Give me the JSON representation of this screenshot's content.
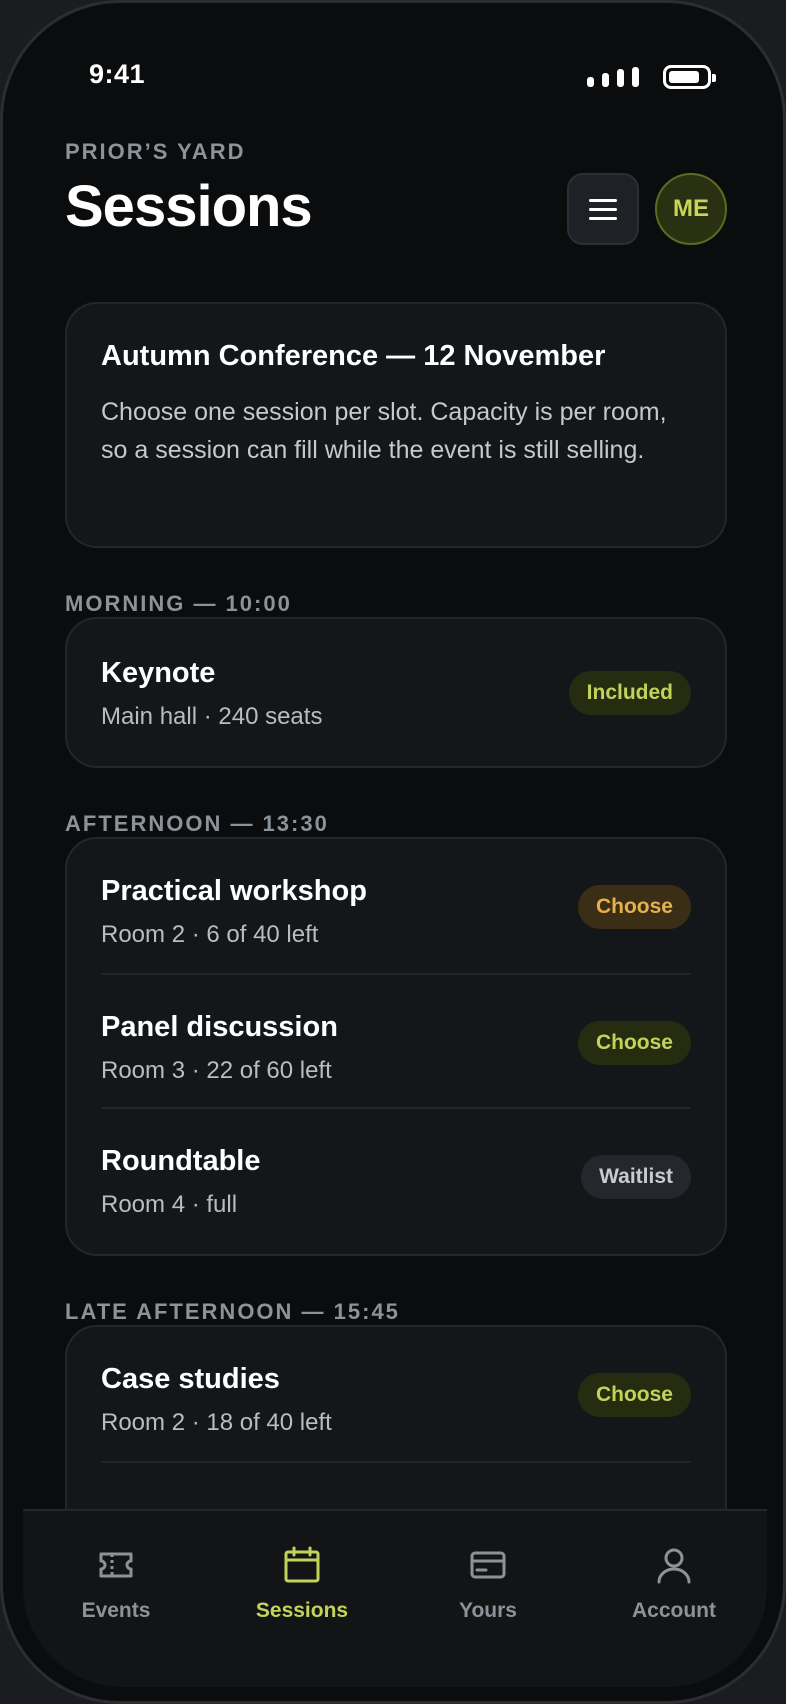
{
  "status_bar": {
    "time": "9:41"
  },
  "header": {
    "overline": "PRIOR’S YARD",
    "title": "Sessions",
    "avatar_initials": "ME"
  },
  "intro": {
    "title": "Autumn Conference — 12 November",
    "body": "Choose one session per slot. Capacity is per room, so a session can fill while the event is still selling."
  },
  "sections": [
    {
      "label": "MORNING — 10:00",
      "sessions": [
        {
          "title": "Keynote",
          "subtitle": "Main hall · 240 seats",
          "action": "Included"
        }
      ]
    },
    {
      "label": "AFTERNOON — 13:30",
      "sessions": [
        {
          "title": "Practical workshop",
          "subtitle": "Room 2 · 6 of 40 left",
          "action": "Choose"
        },
        {
          "title": "Panel discussion",
          "subtitle": "Room 3 · 22 of 60 left",
          "action": "Choose"
        },
        {
          "title": "Roundtable",
          "subtitle": "Room 4 · full",
          "action": "Waitlist"
        }
      ]
    },
    {
      "label": "LATE AFTERNOON — 15:45",
      "sessions": [
        {
          "title": "Case studies",
          "subtitle": "Room 2 · 18 of 40 left",
          "action": "Choose"
        }
      ]
    }
  ],
  "tabs": [
    {
      "label": "Events",
      "icon": "ticket-icon"
    },
    {
      "label": "Sessions",
      "icon": "calendar-icon"
    },
    {
      "label": "Yours",
      "icon": "card-icon"
    },
    {
      "label": "Account",
      "icon": "person-icon"
    }
  ],
  "colors": {
    "accent": "#c3d35a",
    "warning": "#e6b04a",
    "background": "#0b0c0d",
    "card": "#141719"
  }
}
